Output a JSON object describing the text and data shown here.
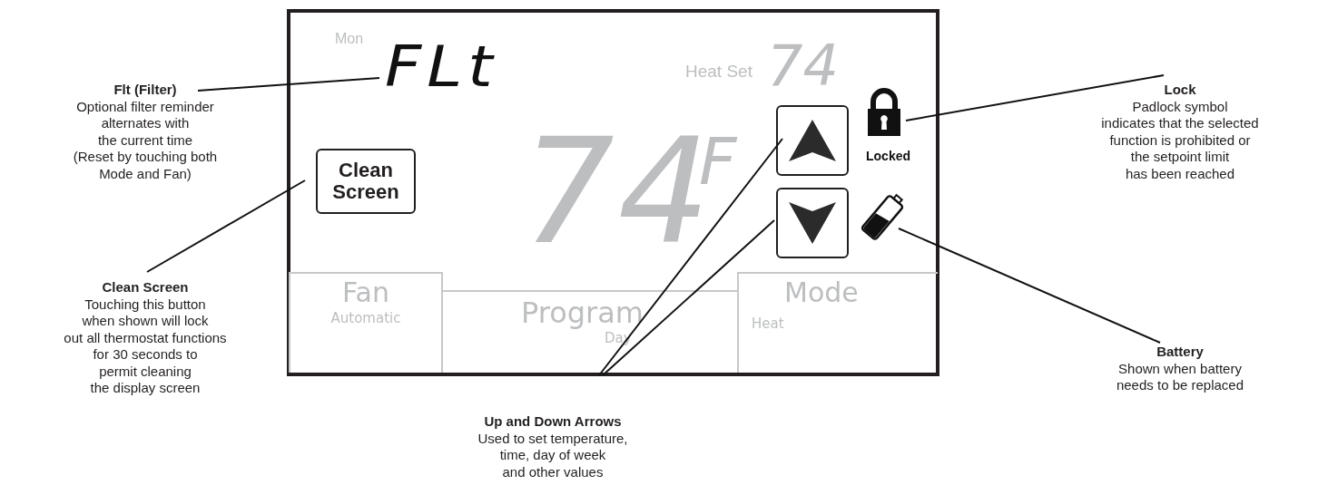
{
  "display": {
    "day": "Mon",
    "filter_code": "FLt",
    "setpoint_label": "Heat Set",
    "setpoint": "74",
    "temperature": "74",
    "unit": "F",
    "clean_button": "Clean Screen",
    "locked": true,
    "lock_label": "Locked",
    "battery_low": true,
    "buttons": [
      {
        "label": "Fan",
        "value": "Automatic"
      },
      {
        "label": "Program",
        "value": "Day"
      },
      {
        "label": "Mode",
        "value": "Heat"
      }
    ]
  },
  "callouts": [
    {
      "title": "Flt (Filter)",
      "text": "Optional filter reminder\nalternates with\nthe current time\n(Reset by touching both\nMode and Fan)"
    },
    {
      "title": "Clean Screen",
      "text": "Touching this button\nwhen shown will lock\nout all thermostat functions\nfor 30 seconds to\npermit cleaning\nthe display screen"
    },
    {
      "title": "Up and Down Arrows",
      "text": "Used to set temperature,\ntime, day of week\nand other values"
    },
    {
      "title": "Lock",
      "text": "Padlock symbol\nindicates that the selected\nfunction is prohibited or\nthe setpoint limit\nhas been reached"
    },
    {
      "title": "Battery",
      "text": "Shown when battery\nneeds to be replaced"
    }
  ]
}
